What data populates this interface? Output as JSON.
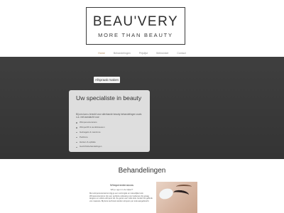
{
  "brand": {
    "name": "BEAU'VERY",
    "tagline": "MORE THAN BEAUTY"
  },
  "nav": {
    "items": [
      "Home",
      "Behandelingen",
      "Prijslijst",
      "Webwinkel",
      "Contact"
    ],
    "active_index": 0,
    "active_color": "#b48a5a"
  },
  "hero": {
    "cta_label": "Afspraak maken",
    "card": {
      "title": "Uw specialiste in beauty",
      "intro": "Bij ons kan u terecht voor allerhande beauty behandelingen zoals o.a. met aandacht voor:",
      "items": [
        "Wimperextensions",
        "Wimperlift & wenkbrauwen",
        "Gelnagels & manicure",
        "Pedicure",
        "Harsen & epilatie",
        "Gezichtsbehandelingen"
      ]
    },
    "background_color": "#3b3b3b"
  },
  "treatments": {
    "section_title": "Behandelingen",
    "tile": {
      "heading": "Wimperextensions",
      "question": "Wil je ogen in de kijker?",
      "paragraph": "Met wimperextensions krijg je een verzorgde en natuurlijke look. Wimperextensions zijn een perfecte oplossing voor iedereen die graag langere en vollere wimpers wil. Ze geven een volle look zonder het gebruik van mascara. Bij deze techniek worden wimpers per stuk aangebracht."
    }
  }
}
